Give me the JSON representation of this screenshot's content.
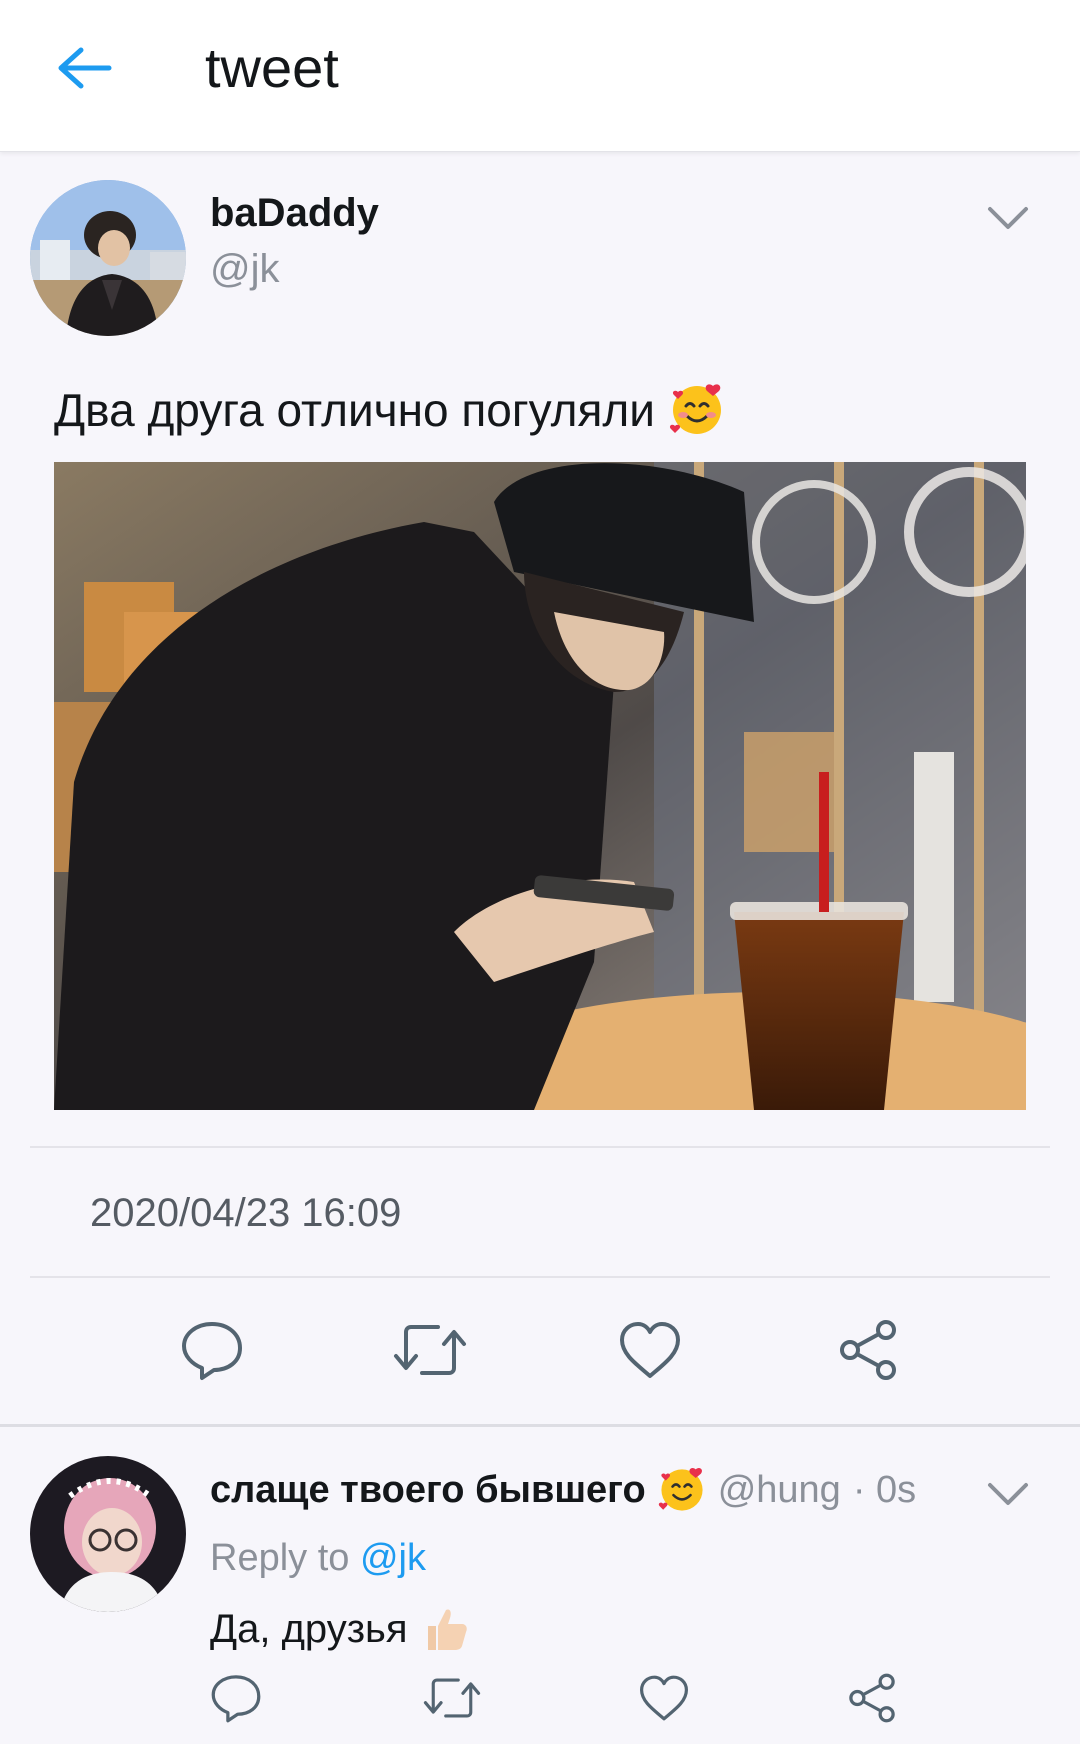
{
  "header": {
    "title": "tweet",
    "accent_color": "#1d9bf0"
  },
  "tweet": {
    "author_name": "baDaddy",
    "author_handle": "@jk",
    "text": "Два друга отлично погуляли",
    "emoji": "smiling-face-with-hearts",
    "timestamp": "2020/04/23 16:09",
    "photo": "cafe-photo"
  },
  "actions": [
    "reply",
    "retweet",
    "like",
    "share"
  ],
  "reply": {
    "author_name": "слаще твоего бывшего",
    "author_emoji": "smiling-face-with-hearts",
    "author_handle": "@hung",
    "time": "· 0s",
    "reply_to_prefix": "Reply to",
    "reply_to_handle": "@jk",
    "text": "Да, друзья",
    "text_emoji": "thumbs-up"
  }
}
